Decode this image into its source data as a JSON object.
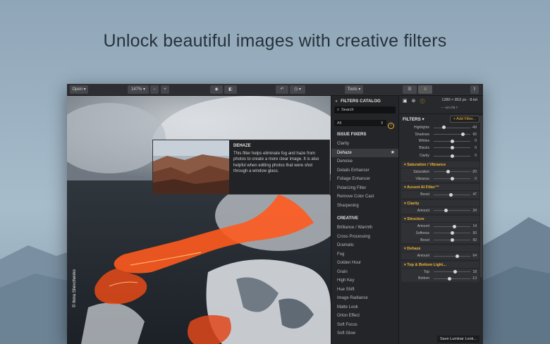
{
  "headline": "Unlock beautiful images with creative filters",
  "toolbar": {
    "open_label": "Open ▾",
    "zoom_label": "147% ▾",
    "zoom_out": "−",
    "zoom_in": "+",
    "tools_label": "Tools ▾"
  },
  "photo": {
    "watermark": "© Ilona Shevchenko"
  },
  "tooltip": {
    "title": "DEHAZE",
    "description": "This filter helps eliminate fog and haze from photos to create a more clear image. It is also helpful when editing photos that were shot through a window glass."
  },
  "catalog": {
    "title": "FILTERS CATALOG",
    "search_placeholder": "Search",
    "category": "All",
    "sections": [
      {
        "title": "ISSUE FIXERS",
        "items": [
          "Clarity",
          "Dehaze",
          "Denoise",
          "Details Enhancer",
          "Foliage Enhancer",
          "Polarizing Filter",
          "Remove Color Cast",
          "Sharpening"
        ]
      },
      {
        "title": "CREATIVE",
        "items": [
          "Brilliance / Warmth",
          "Cross Processing",
          "Dramatic",
          "Fog",
          "Golden Hour",
          "Grain",
          "High Key",
          "Hue Shift",
          "Image Radiance",
          "Matte Look",
          "Orton Effect",
          "Soft Focus",
          "Soft Glow"
        ]
      }
    ],
    "selected": "Dehaze"
  },
  "panel": {
    "dimensions": "1280 × 853 px  ·  8-bit",
    "sub_info": "--- mm   f/8.7",
    "filters_label": "FILTERS ▾",
    "add_filter_label": "+ Add Filter...",
    "top_sliders": [
      {
        "label": "Highlights",
        "value": "-49",
        "pos": 0.27
      },
      {
        "label": "Shadows",
        "value": "60",
        "pos": 0.8
      },
      {
        "label": "Whites",
        "value": "0",
        "pos": 0.5
      },
      {
        "label": "Blacks",
        "value": "0",
        "pos": 0.5
      }
    ],
    "clarity_slider": {
      "label": "Clarity",
      "value": "0",
      "pos": 0.5
    },
    "groups": [
      {
        "title": "Saturation / Vibrance",
        "sliders": [
          {
            "label": "Saturation",
            "value": "-20",
            "pos": 0.4
          },
          {
            "label": "Vibrance",
            "value": "0",
            "pos": 0.5
          }
        ]
      },
      {
        "title": "Accent AI Filter™",
        "sliders": [
          {
            "label": "Boost",
            "value": "47",
            "pos": 0.47
          }
        ]
      },
      {
        "title": "Clarity",
        "sliders": [
          {
            "label": "Amount",
            "value": "34",
            "pos": 0.34
          }
        ]
      },
      {
        "title": "Structure",
        "sliders": [
          {
            "label": "Amount",
            "value": "14",
            "pos": 0.57
          },
          {
            "label": "Softness",
            "value": "50",
            "pos": 0.5
          },
          {
            "label": "Boost",
            "value": "50",
            "pos": 0.5
          }
        ]
      },
      {
        "title": "Dehaze",
        "sliders": [
          {
            "label": "Amount",
            "value": "64",
            "pos": 0.64
          }
        ]
      },
      {
        "title": "Top & Bottom Light...",
        "sliders": [
          {
            "label": "Top",
            "value": "18",
            "pos": 0.59
          },
          {
            "label": "Bottom",
            "value": "-13",
            "pos": 0.43
          }
        ]
      }
    ],
    "save_look_label": "Save Luminar Look..."
  },
  "colors": {
    "accent": "#f1b633",
    "lava": "#ff5a1e"
  }
}
